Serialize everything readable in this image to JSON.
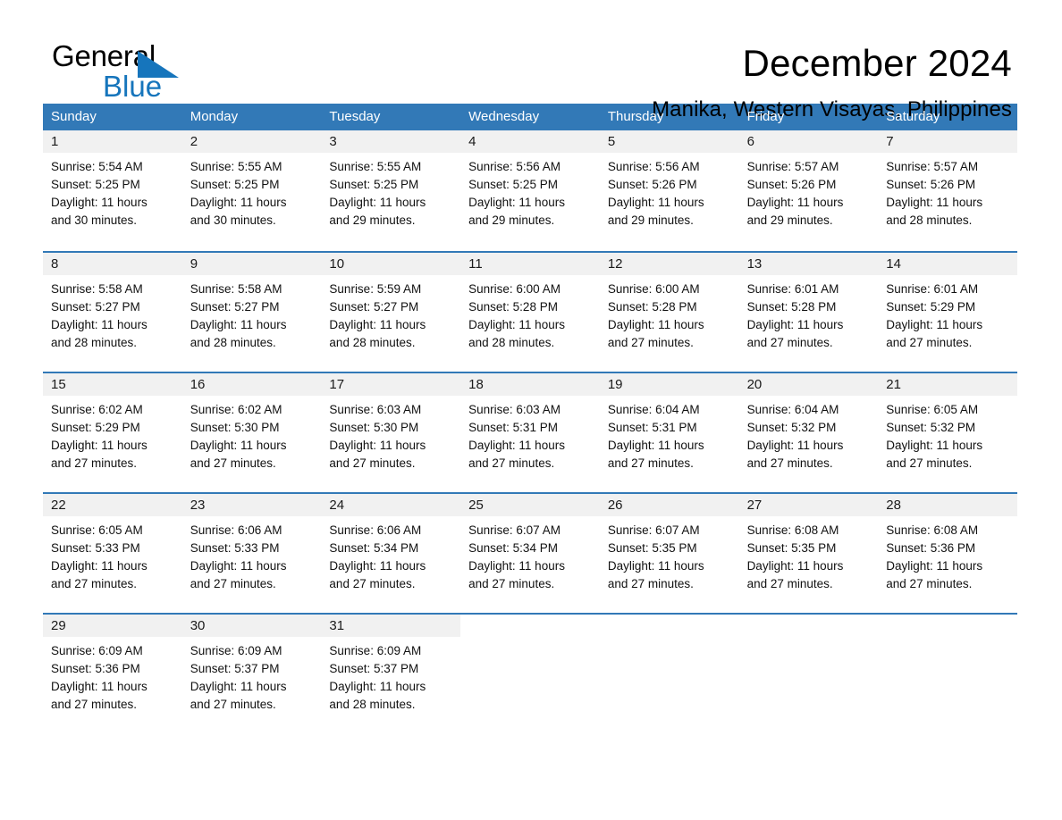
{
  "brand": {
    "name_part1": "General",
    "name_part2": "Blue",
    "accent_color": "#1675bc"
  },
  "header": {
    "title": "December 2024",
    "subtitle": "Manika, Western Visayas, Philippines"
  },
  "calendar": {
    "header_bg": "#3279b7",
    "daynum_bg": "#f1f1f1",
    "day_names": [
      "Sunday",
      "Monday",
      "Tuesday",
      "Wednesday",
      "Thursday",
      "Friday",
      "Saturday"
    ],
    "weeks": [
      [
        {
          "day": "1",
          "sunrise": "Sunrise: 5:54 AM",
          "sunset": "Sunset: 5:25 PM",
          "daylight_line1": "Daylight: 11 hours",
          "daylight_line2": "and 30 minutes."
        },
        {
          "day": "2",
          "sunrise": "Sunrise: 5:55 AM",
          "sunset": "Sunset: 5:25 PM",
          "daylight_line1": "Daylight: 11 hours",
          "daylight_line2": "and 30 minutes."
        },
        {
          "day": "3",
          "sunrise": "Sunrise: 5:55 AM",
          "sunset": "Sunset: 5:25 PM",
          "daylight_line1": "Daylight: 11 hours",
          "daylight_line2": "and 29 minutes."
        },
        {
          "day": "4",
          "sunrise": "Sunrise: 5:56 AM",
          "sunset": "Sunset: 5:25 PM",
          "daylight_line1": "Daylight: 11 hours",
          "daylight_line2": "and 29 minutes."
        },
        {
          "day": "5",
          "sunrise": "Sunrise: 5:56 AM",
          "sunset": "Sunset: 5:26 PM",
          "daylight_line1": "Daylight: 11 hours",
          "daylight_line2": "and 29 minutes."
        },
        {
          "day": "6",
          "sunrise": "Sunrise: 5:57 AM",
          "sunset": "Sunset: 5:26 PM",
          "daylight_line1": "Daylight: 11 hours",
          "daylight_line2": "and 29 minutes."
        },
        {
          "day": "7",
          "sunrise": "Sunrise: 5:57 AM",
          "sunset": "Sunset: 5:26 PM",
          "daylight_line1": "Daylight: 11 hours",
          "daylight_line2": "and 28 minutes."
        }
      ],
      [
        {
          "day": "8",
          "sunrise": "Sunrise: 5:58 AM",
          "sunset": "Sunset: 5:27 PM",
          "daylight_line1": "Daylight: 11 hours",
          "daylight_line2": "and 28 minutes."
        },
        {
          "day": "9",
          "sunrise": "Sunrise: 5:58 AM",
          "sunset": "Sunset: 5:27 PM",
          "daylight_line1": "Daylight: 11 hours",
          "daylight_line2": "and 28 minutes."
        },
        {
          "day": "10",
          "sunrise": "Sunrise: 5:59 AM",
          "sunset": "Sunset: 5:27 PM",
          "daylight_line1": "Daylight: 11 hours",
          "daylight_line2": "and 28 minutes."
        },
        {
          "day": "11",
          "sunrise": "Sunrise: 6:00 AM",
          "sunset": "Sunset: 5:28 PM",
          "daylight_line1": "Daylight: 11 hours",
          "daylight_line2": "and 28 minutes."
        },
        {
          "day": "12",
          "sunrise": "Sunrise: 6:00 AM",
          "sunset": "Sunset: 5:28 PM",
          "daylight_line1": "Daylight: 11 hours",
          "daylight_line2": "and 27 minutes."
        },
        {
          "day": "13",
          "sunrise": "Sunrise: 6:01 AM",
          "sunset": "Sunset: 5:28 PM",
          "daylight_line1": "Daylight: 11 hours",
          "daylight_line2": "and 27 minutes."
        },
        {
          "day": "14",
          "sunrise": "Sunrise: 6:01 AM",
          "sunset": "Sunset: 5:29 PM",
          "daylight_line1": "Daylight: 11 hours",
          "daylight_line2": "and 27 minutes."
        }
      ],
      [
        {
          "day": "15",
          "sunrise": "Sunrise: 6:02 AM",
          "sunset": "Sunset: 5:29 PM",
          "daylight_line1": "Daylight: 11 hours",
          "daylight_line2": "and 27 minutes."
        },
        {
          "day": "16",
          "sunrise": "Sunrise: 6:02 AM",
          "sunset": "Sunset: 5:30 PM",
          "daylight_line1": "Daylight: 11 hours",
          "daylight_line2": "and 27 minutes."
        },
        {
          "day": "17",
          "sunrise": "Sunrise: 6:03 AM",
          "sunset": "Sunset: 5:30 PM",
          "daylight_line1": "Daylight: 11 hours",
          "daylight_line2": "and 27 minutes."
        },
        {
          "day": "18",
          "sunrise": "Sunrise: 6:03 AM",
          "sunset": "Sunset: 5:31 PM",
          "daylight_line1": "Daylight: 11 hours",
          "daylight_line2": "and 27 minutes."
        },
        {
          "day": "19",
          "sunrise": "Sunrise: 6:04 AM",
          "sunset": "Sunset: 5:31 PM",
          "daylight_line1": "Daylight: 11 hours",
          "daylight_line2": "and 27 minutes."
        },
        {
          "day": "20",
          "sunrise": "Sunrise: 6:04 AM",
          "sunset": "Sunset: 5:32 PM",
          "daylight_line1": "Daylight: 11 hours",
          "daylight_line2": "and 27 minutes."
        },
        {
          "day": "21",
          "sunrise": "Sunrise: 6:05 AM",
          "sunset": "Sunset: 5:32 PM",
          "daylight_line1": "Daylight: 11 hours",
          "daylight_line2": "and 27 minutes."
        }
      ],
      [
        {
          "day": "22",
          "sunrise": "Sunrise: 6:05 AM",
          "sunset": "Sunset: 5:33 PM",
          "daylight_line1": "Daylight: 11 hours",
          "daylight_line2": "and 27 minutes."
        },
        {
          "day": "23",
          "sunrise": "Sunrise: 6:06 AM",
          "sunset": "Sunset: 5:33 PM",
          "daylight_line1": "Daylight: 11 hours",
          "daylight_line2": "and 27 minutes."
        },
        {
          "day": "24",
          "sunrise": "Sunrise: 6:06 AM",
          "sunset": "Sunset: 5:34 PM",
          "daylight_line1": "Daylight: 11 hours",
          "daylight_line2": "and 27 minutes."
        },
        {
          "day": "25",
          "sunrise": "Sunrise: 6:07 AM",
          "sunset": "Sunset: 5:34 PM",
          "daylight_line1": "Daylight: 11 hours",
          "daylight_line2": "and 27 minutes."
        },
        {
          "day": "26",
          "sunrise": "Sunrise: 6:07 AM",
          "sunset": "Sunset: 5:35 PM",
          "daylight_line1": "Daylight: 11 hours",
          "daylight_line2": "and 27 minutes."
        },
        {
          "day": "27",
          "sunrise": "Sunrise: 6:08 AM",
          "sunset": "Sunset: 5:35 PM",
          "daylight_line1": "Daylight: 11 hours",
          "daylight_line2": "and 27 minutes."
        },
        {
          "day": "28",
          "sunrise": "Sunrise: 6:08 AM",
          "sunset": "Sunset: 5:36 PM",
          "daylight_line1": "Daylight: 11 hours",
          "daylight_line2": "and 27 minutes."
        }
      ],
      [
        {
          "day": "29",
          "sunrise": "Sunrise: 6:09 AM",
          "sunset": "Sunset: 5:36 PM",
          "daylight_line1": "Daylight: 11 hours",
          "daylight_line2": "and 27 minutes."
        },
        {
          "day": "30",
          "sunrise": "Sunrise: 6:09 AM",
          "sunset": "Sunset: 5:37 PM",
          "daylight_line1": "Daylight: 11 hours",
          "daylight_line2": "and 27 minutes."
        },
        {
          "day": "31",
          "sunrise": "Sunrise: 6:09 AM",
          "sunset": "Sunset: 5:37 PM",
          "daylight_line1": "Daylight: 11 hours",
          "daylight_line2": "and 28 minutes."
        },
        {
          "day": "",
          "sunrise": "",
          "sunset": "",
          "daylight_line1": "",
          "daylight_line2": ""
        },
        {
          "day": "",
          "sunrise": "",
          "sunset": "",
          "daylight_line1": "",
          "daylight_line2": ""
        },
        {
          "day": "",
          "sunrise": "",
          "sunset": "",
          "daylight_line1": "",
          "daylight_line2": ""
        },
        {
          "day": "",
          "sunrise": "",
          "sunset": "",
          "daylight_line1": "",
          "daylight_line2": ""
        }
      ]
    ]
  }
}
